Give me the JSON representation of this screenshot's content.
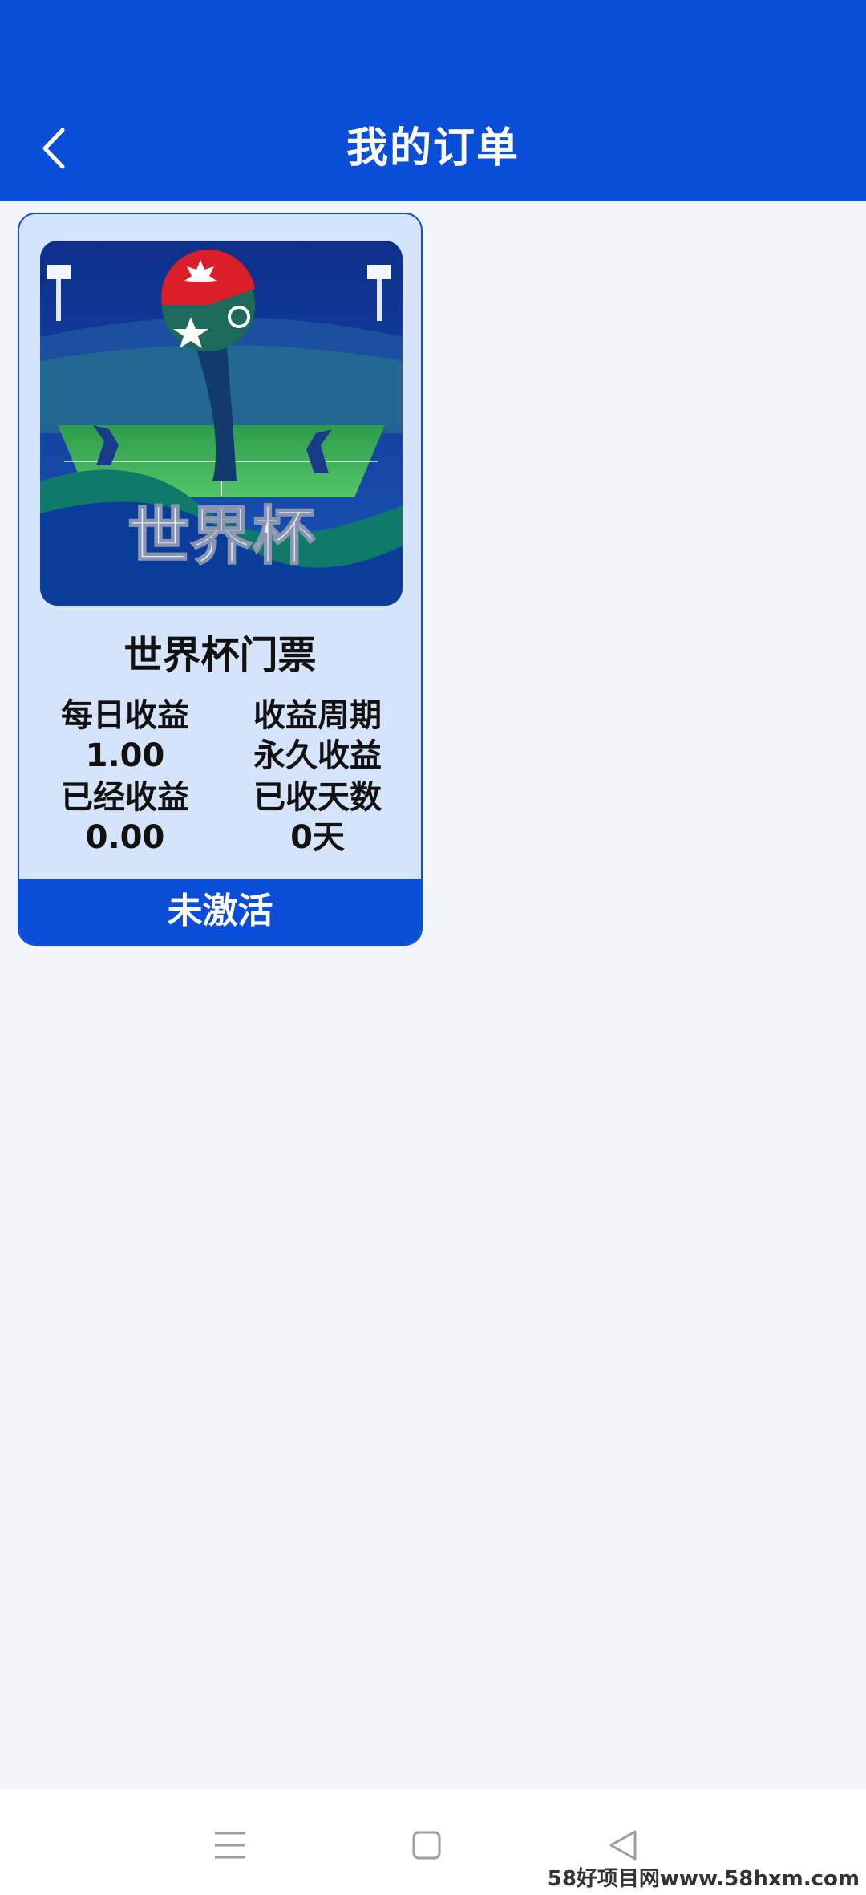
{
  "header": {
    "title": "我的订单",
    "back_icon": "chevron-left-icon"
  },
  "colors": {
    "primary": "#0a4ed8",
    "card_bg": "#d6e4fb",
    "page_bg": "#f3f5fa"
  },
  "orders": [
    {
      "product_name": "世界杯门票",
      "image_caption": "世界杯",
      "daily_income_label": "每日收益",
      "daily_income_value": "1.00",
      "income_period_label": "收益周期",
      "income_period_value": "永久收益",
      "earned_label": "已经收益",
      "earned_value": "0.00",
      "days_collected_label": "已收天数",
      "days_collected_value": "0天",
      "status": "未激活"
    }
  ],
  "system_nav": {
    "menu_icon": "menu-icon",
    "home_icon": "square-home-icon",
    "back_icon": "triangle-back-icon"
  },
  "watermark": "58好项目网www.58hxm.com"
}
